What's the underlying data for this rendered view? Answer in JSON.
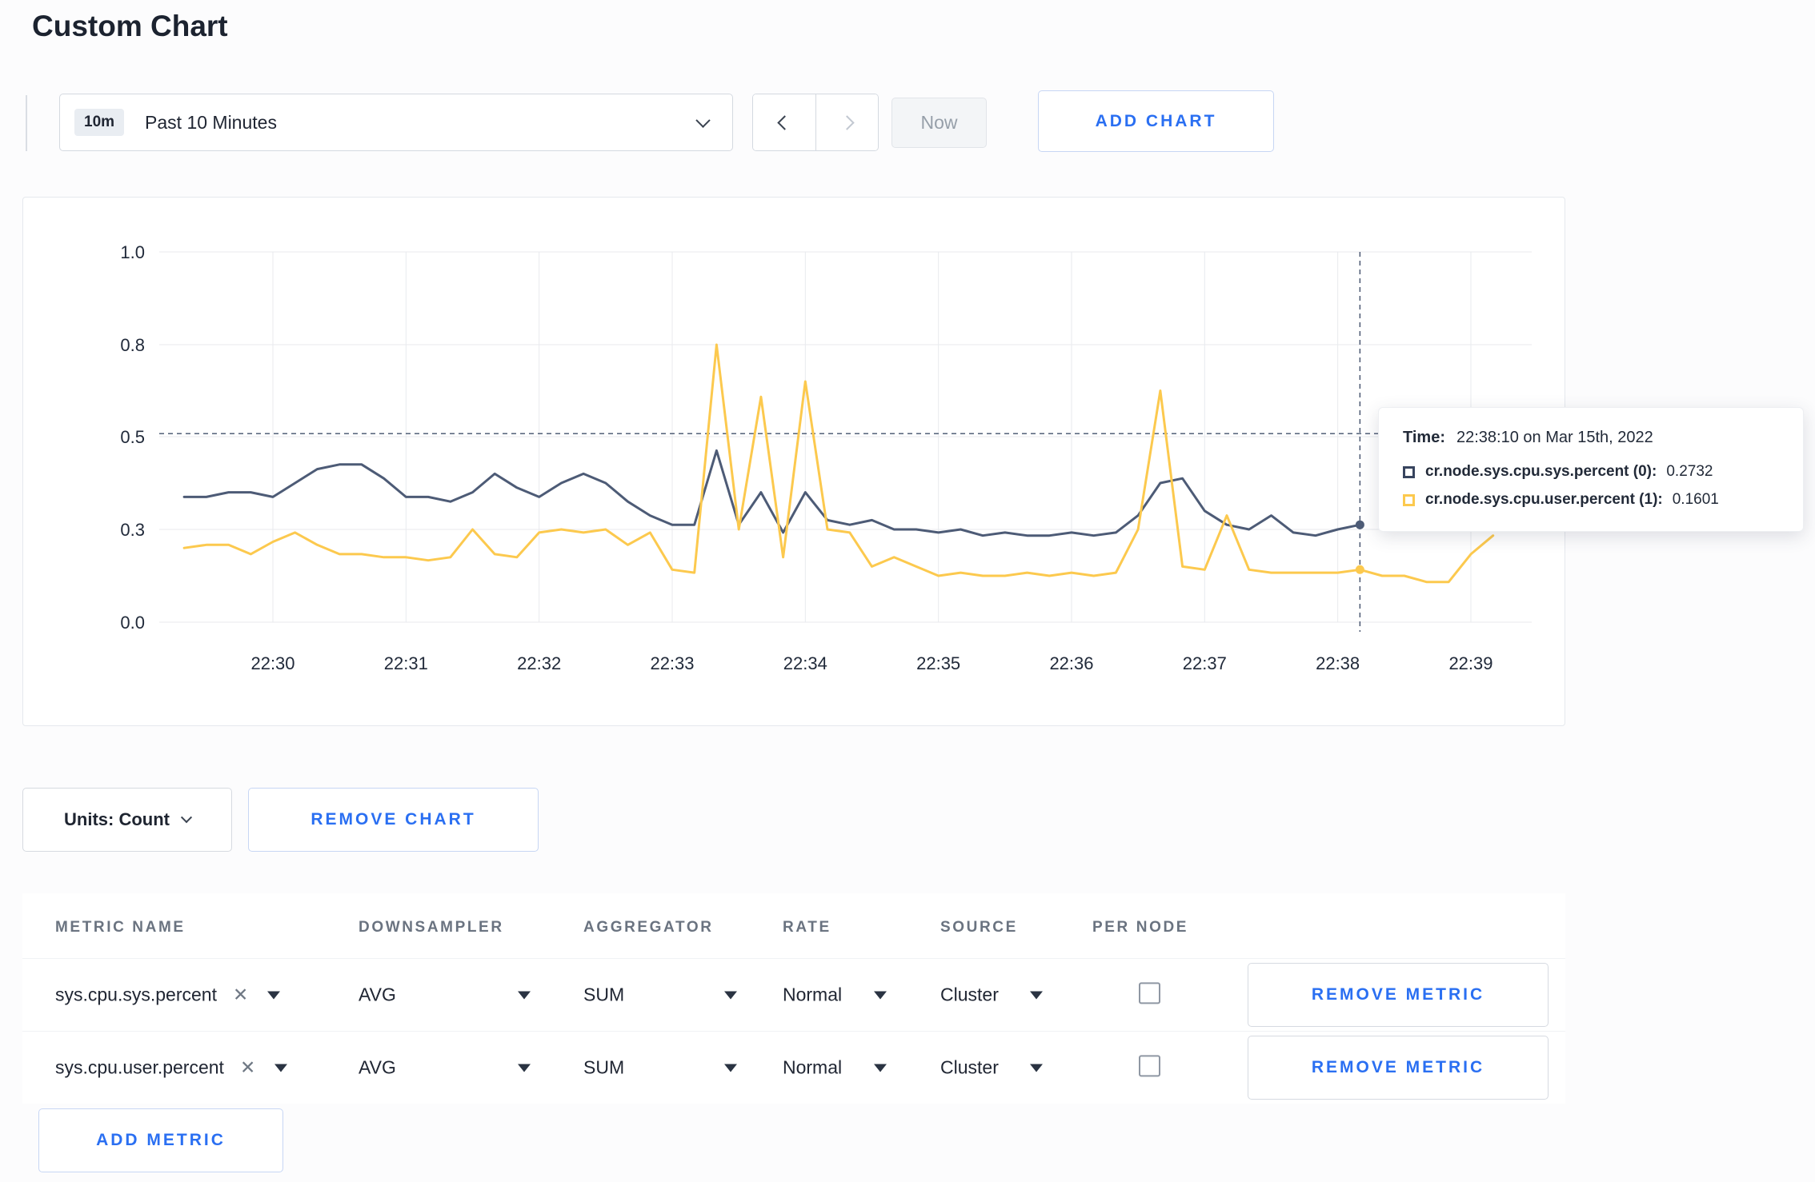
{
  "page": {
    "title": "Custom Chart"
  },
  "colors": {
    "accent_blue": "#2a6ff2",
    "series_sys": "#4d5b76",
    "series_user": "#fcc94e",
    "grid": "#e8eaee"
  },
  "toolbar": {
    "time_chip": "10m",
    "time_range": "Past 10 Minutes",
    "now_label": "Now",
    "add_chart_label": "ADD CHART"
  },
  "icons": {
    "close_glyph": "✕"
  },
  "controls": {
    "units_label": "Units: Count",
    "remove_chart_label": "REMOVE CHART",
    "add_metric_label": "ADD METRIC"
  },
  "tooltip": {
    "time_label": "Time:",
    "time_value": "22:38:10 on Mar 15th, 2022",
    "series": [
      {
        "label": "cr.node.sys.cpu.sys.percent (0):",
        "value": "0.2732",
        "color": "#37445e"
      },
      {
        "label": "cr.node.sys.cpu.user.percent (1):",
        "value": "0.1601",
        "color": "#fcc94e"
      }
    ]
  },
  "metrics_table": {
    "headers": [
      "METRIC NAME",
      "DOWNSAMPLER",
      "AGGREGATOR",
      "RATE",
      "SOURCE",
      "PER NODE"
    ],
    "remove_metric_label": "REMOVE METRIC",
    "rows": [
      {
        "metric": "sys.cpu.sys.percent",
        "downsampler": "AVG",
        "aggregator": "SUM",
        "rate": "Normal",
        "source": "Cluster",
        "per_node": false
      },
      {
        "metric": "sys.cpu.user.percent",
        "downsampler": "AVG",
        "aggregator": "SUM",
        "rate": "Normal",
        "source": "Cluster",
        "per_node": false
      }
    ]
  },
  "chart_data": {
    "type": "line",
    "title": "",
    "x_axis": {
      "tick_labels": [
        "22:30",
        "22:31",
        "22:32",
        "22:33",
        "22:34",
        "22:35",
        "22:36",
        "22:37",
        "22:38",
        "22:39"
      ],
      "tick_interval_seconds": 60
    },
    "y_axis": {
      "tick_labels": [
        "0.0",
        "0.3",
        "0.5",
        "0.8",
        "1.0"
      ],
      "tick_values": [
        0,
        0.3,
        0.5,
        0.8,
        1.0
      ]
    },
    "crosshair": {
      "time_seconds": 490,
      "value": 0.51,
      "time_label": "22:38:10"
    },
    "sample_start_seconds": -40,
    "sample_interval_seconds": 10,
    "series": [
      {
        "name": "cr.node.sys.cpu.sys.percent",
        "color": "#4d5b76",
        "marker_seconds": 490,
        "values": [
          0.37,
          0.37,
          0.38,
          0.38,
          0.37,
          0.4,
          0.43,
          0.44,
          0.44,
          0.41,
          0.37,
          0.37,
          0.36,
          0.38,
          0.42,
          0.39,
          0.37,
          0.4,
          0.42,
          0.4,
          0.36,
          0.33,
          0.31,
          0.31,
          0.47,
          0.31,
          0.38,
          0.29,
          0.38,
          0.32,
          0.31,
          0.32,
          0.3,
          0.3,
          0.29,
          0.3,
          0.28,
          0.29,
          0.28,
          0.28,
          0.29,
          0.28,
          0.29,
          0.33,
          0.4,
          0.41,
          0.34,
          0.31,
          0.3,
          0.33,
          0.29,
          0.28,
          0.3,
          0.31
        ]
      },
      {
        "name": "cr.node.sys.cpu.user.percent",
        "color": "#fcc94e",
        "marker_seconds": 490,
        "values": [
          0.24,
          0.25,
          0.25,
          0.22,
          0.26,
          0.29,
          0.25,
          0.22,
          0.22,
          0.21,
          0.21,
          0.2,
          0.21,
          0.3,
          0.22,
          0.21,
          0.29,
          0.3,
          0.29,
          0.3,
          0.25,
          0.29,
          0.17,
          0.16,
          0.8,
          0.3,
          0.63,
          0.21,
          0.68,
          0.3,
          0.29,
          0.18,
          0.21,
          0.18,
          0.15,
          0.16,
          0.15,
          0.15,
          0.16,
          0.15,
          0.16,
          0.15,
          0.16,
          0.3,
          0.65,
          0.18,
          0.17,
          0.33,
          0.17,
          0.16,
          0.16,
          0.16,
          0.16,
          0.17,
          0.15,
          0.15,
          0.13,
          0.13,
          0.22,
          0.28
        ]
      }
    ]
  }
}
